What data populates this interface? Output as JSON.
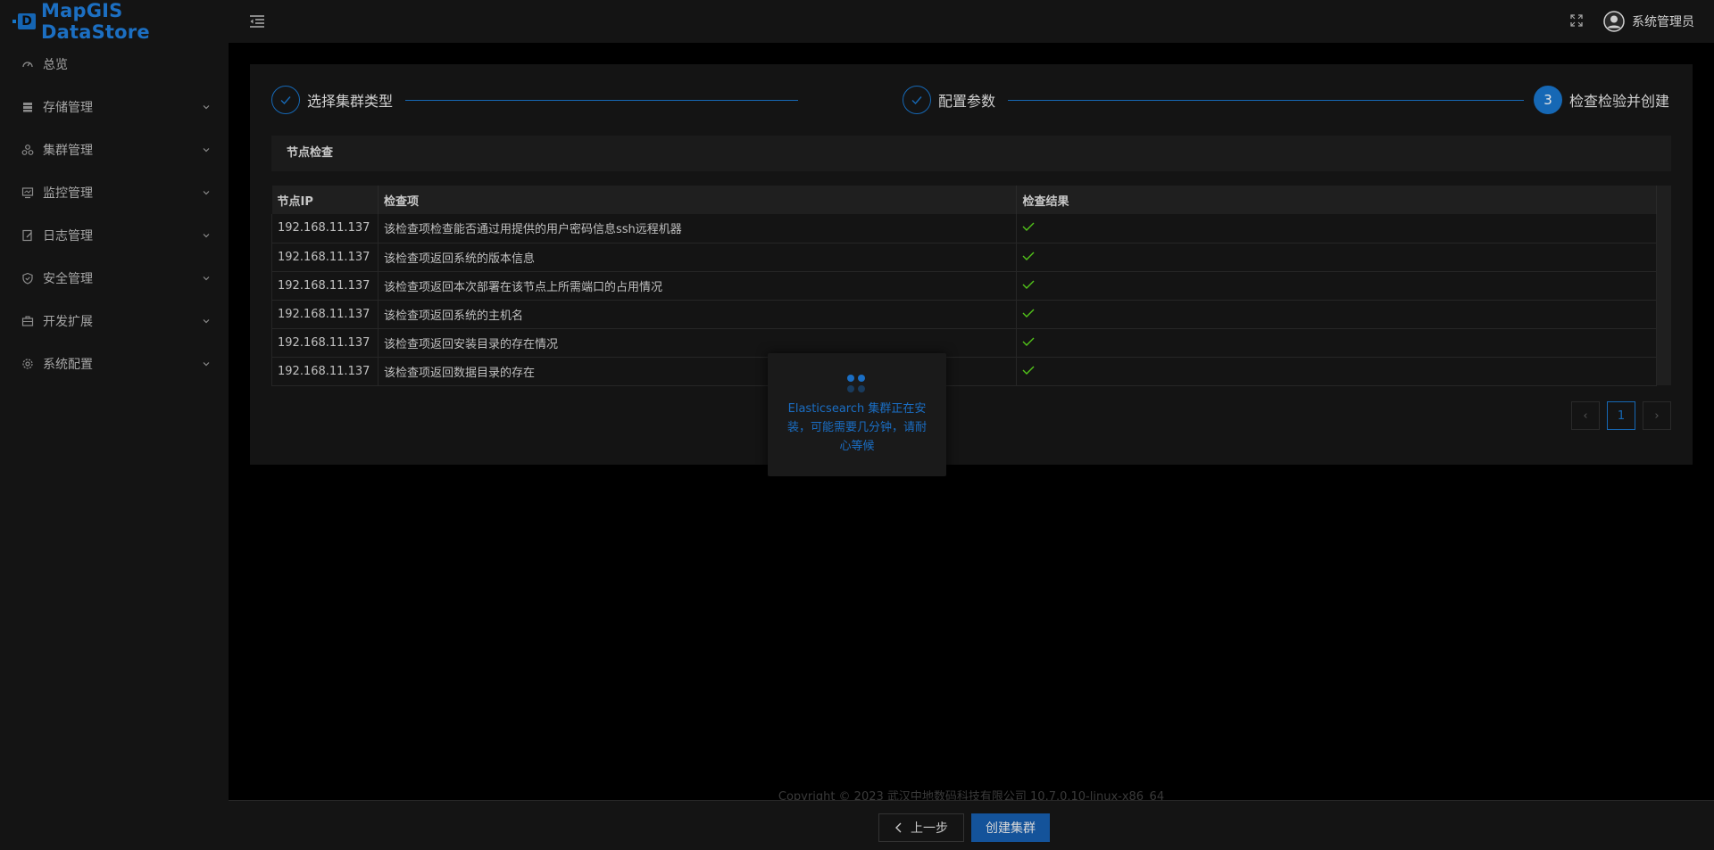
{
  "app": {
    "logo_box": "D",
    "logo_text": "MapGIS DataStore"
  },
  "sidebar": {
    "items": [
      {
        "label": "总览",
        "icon": "dashboard-icon",
        "expandable": false
      },
      {
        "label": "存储管理",
        "icon": "storage-icon",
        "expandable": true
      },
      {
        "label": "集群管理",
        "icon": "cluster-icon",
        "expandable": true
      },
      {
        "label": "监控管理",
        "icon": "monitor-icon",
        "expandable": true
      },
      {
        "label": "日志管理",
        "icon": "log-icon",
        "expandable": true
      },
      {
        "label": "安全管理",
        "icon": "shield-icon",
        "expandable": true
      },
      {
        "label": "开发扩展",
        "icon": "toolbox-icon",
        "expandable": true
      },
      {
        "label": "系统配置",
        "icon": "gear-icon",
        "expandable": true
      }
    ]
  },
  "header": {
    "user_name": "系统管理员"
  },
  "steps": [
    {
      "title": "选择集群类型",
      "status": "done",
      "number": ""
    },
    {
      "title": "配置参数",
      "status": "done",
      "number": ""
    },
    {
      "title": "检查检验并创建",
      "status": "active",
      "number": "3"
    }
  ],
  "section": {
    "title": "节点检查"
  },
  "table": {
    "headers": [
      "节点IP",
      "检查项",
      "检查结果"
    ],
    "rows": [
      {
        "ip": "192.168.11.137",
        "item": "该检查项检查能否通过用提供的用户密码信息ssh远程机器",
        "result": "pass"
      },
      {
        "ip": "192.168.11.137",
        "item": "该检查项返回系统的版本信息",
        "result": "pass"
      },
      {
        "ip": "192.168.11.137",
        "item": "该检查项返回本次部署在该节点上所需端口的占用情况",
        "result": "pass"
      },
      {
        "ip": "192.168.11.137",
        "item": "该检查项返回系统的主机名",
        "result": "pass"
      },
      {
        "ip": "192.168.11.137",
        "item": "该检查项返回安装目录的存在情况",
        "result": "pass"
      },
      {
        "ip": "192.168.11.137",
        "item": "该检查项返回数据目录的存在",
        "result": "pass"
      }
    ]
  },
  "pagination": {
    "prev": "‹",
    "current": "1",
    "next": "›"
  },
  "loading": {
    "text": "Elasticsearch 集群正在安装，可能需要几分钟，请耐心等候"
  },
  "footer": {
    "copyright": "Copyright © 2023 武汉中地数码科技有限公司 10.7.0.10-linux-x86_64",
    "prev_label": "上一步",
    "create_label": "创建集群"
  },
  "colors": {
    "accent": "#1668b5",
    "success": "#52c41a",
    "sidebar_bg": "#141414",
    "page_bg": "#000000"
  }
}
